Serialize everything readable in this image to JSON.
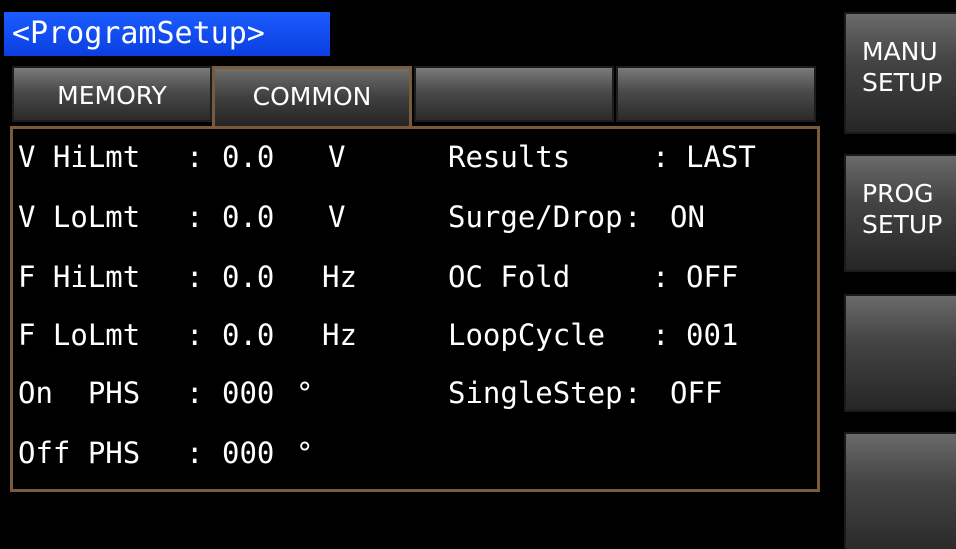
{
  "title": "<ProgramSetup>",
  "tabs": [
    {
      "label": "MEMORY",
      "active": false
    },
    {
      "label": "COMMON",
      "active": true
    },
    {
      "label": "",
      "active": false
    },
    {
      "label": "",
      "active": false
    }
  ],
  "params_left": [
    {
      "name": "V HiLmt",
      "sep": ":",
      "value": "0.0",
      "unit": "V"
    },
    {
      "name": "V LoLmt",
      "sep": ":",
      "value": "0.0",
      "unit": "V"
    },
    {
      "name": "F HiLmt",
      "sep": ":",
      "value": "0.0",
      "unit": "Hz"
    },
    {
      "name": "F LoLmt",
      "sep": ":",
      "value": "0.0",
      "unit": "Hz"
    },
    {
      "name": "On  PHS",
      "sep": ":",
      "value": "000",
      "unit": "°"
    },
    {
      "name": "Off PHS",
      "sep": ":",
      "value": "000",
      "unit": "°"
    }
  ],
  "params_right": [
    {
      "name": "Results",
      "sep": ":",
      "value": "LAST"
    },
    {
      "name": "Surge/Drop",
      "sep": ":",
      "value": "ON"
    },
    {
      "name": "OC Fold",
      "sep": ":",
      "value": "OFF"
    },
    {
      "name": "LoopCycle",
      "sep": ":",
      "value": "001"
    },
    {
      "name": "SingleStep",
      "sep": ":",
      "value": "OFF"
    }
  ],
  "softkeys": [
    {
      "line1": "MANU",
      "line2": "SETUP"
    },
    {
      "line1": "PROG",
      "line2": "SETUP"
    },
    {
      "line1": "",
      "line2": ""
    },
    {
      "line1": "",
      "line2": ""
    }
  ],
  "colors": {
    "screen_bg": "#000000",
    "title_bg": "#1b5cff",
    "panel_border": "#7a5a3a",
    "text": "#ffffff"
  }
}
